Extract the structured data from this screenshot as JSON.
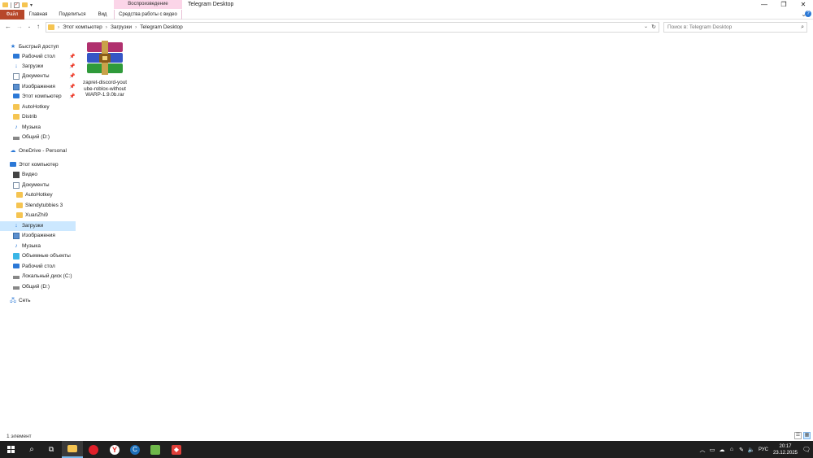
{
  "window": {
    "title": "Telegram Desktop",
    "context_tab_header": "Воспроизведение",
    "minimize_glyph": "—",
    "restore_glyph": "❐",
    "close_glyph": "✕"
  },
  "ribbon": {
    "tabs": [
      "Файл",
      "Главная",
      "Поделиться",
      "Вид"
    ],
    "context_tab": "Средства работы с видео",
    "file_tab_color": "#b7472a"
  },
  "address": {
    "crumbs": [
      "Этот компьютер",
      "Загрузки",
      "Telegram Desktop"
    ]
  },
  "search": {
    "placeholder": "Поиск в: Telegram Desktop"
  },
  "nav": {
    "quick_access": "Быстрый доступ",
    "quick_items": [
      {
        "label": "Рабочий стол",
        "icon": "desktop-icon",
        "pinned": true
      },
      {
        "label": "Загрузки",
        "icon": "download-icon",
        "pinned": true
      },
      {
        "label": "Документы",
        "icon": "documents-icon",
        "pinned": true
      },
      {
        "label": "Изображения",
        "icon": "pictures-icon",
        "pinned": true
      },
      {
        "label": "Этот компьютер",
        "icon": "computer-icon",
        "pinned": true
      },
      {
        "label": "AutoHotkey",
        "icon": "folder-icon",
        "pinned": false
      },
      {
        "label": "Distrib",
        "icon": "folder-icon",
        "pinned": false
      },
      {
        "label": "Музыка",
        "icon": "music-icon",
        "pinned": false
      },
      {
        "label": "Общий (D:)",
        "icon": "drive-icon",
        "pinned": false
      }
    ],
    "onedrive": "OneDrive - Personal",
    "this_pc": "Этот компьютер",
    "pc_items": [
      {
        "label": "Видео",
        "icon": "video-icon"
      },
      {
        "label": "Документы",
        "icon": "documents-icon"
      },
      {
        "label": "AutoHotkey",
        "icon": "folder-icon"
      },
      {
        "label": "Slendytubbies 3",
        "icon": "folder-icon"
      },
      {
        "label": "XuanZhi9",
        "icon": "folder-icon"
      },
      {
        "label": "Загрузки",
        "icon": "download-icon",
        "selected": true
      },
      {
        "label": "Изображения",
        "icon": "pictures-icon"
      },
      {
        "label": "Музыка",
        "icon": "music-icon"
      },
      {
        "label": "Объемные объекты",
        "icon": "3d-objects-icon"
      },
      {
        "label": "Рабочий стол",
        "icon": "desktop-icon"
      },
      {
        "label": "Локальный диск (C:)",
        "icon": "drive-icon"
      },
      {
        "label": "Общий (D:)",
        "icon": "drive-icon"
      }
    ],
    "network": "Сеть",
    "selected_color": "#cce8ff"
  },
  "files": [
    {
      "name": "zapret-discord-youtube-roblox-withoutWARP-1.9.0b.rar",
      "icon": "winrar-archive-icon"
    }
  ],
  "status": {
    "count": "1 элемент"
  },
  "taskbar": {
    "lang": "РУС",
    "time": "20:17",
    "date": "23.12.2025"
  }
}
